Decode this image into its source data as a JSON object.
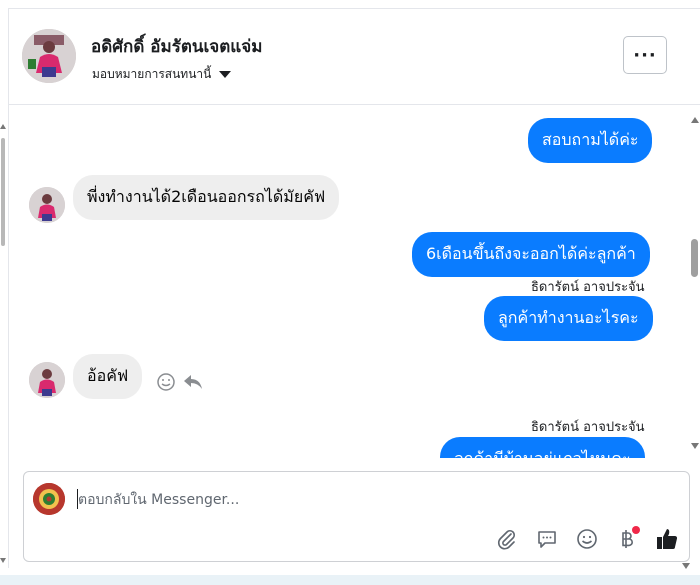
{
  "header": {
    "contact_name": "อดิศักดิ์ อัมรัตนเจตแจ่ม",
    "assign_label": "มอบหมายการสนทนานี้",
    "more_label": "···"
  },
  "messages": [
    {
      "direction": "out",
      "text": "สอบถามได้ค่ะ"
    },
    {
      "direction": "in",
      "text": "พี่งทำงานได้2เดือนออกรถได้มัยคัฟ"
    },
    {
      "direction": "out",
      "text": "6เดือนขึ้นถึงจะออกได้ค่ะลูกค้า"
    },
    {
      "direction": "out",
      "sender": "ธิดารัตน์ อาจประจัน",
      "text": "ลูกค้าทำงานอะไรคะ"
    },
    {
      "direction": "in",
      "text": "อ้อคัฟ"
    },
    {
      "direction": "out",
      "sender": "ธิดารัตน์ อาจประจัน",
      "text": "ลูกค้ามีบ้านอยู่แถวไหนคะ"
    }
  ],
  "composer": {
    "placeholder": "ตอบกลับใน Messenger..."
  },
  "icons": {
    "more": "more-horizontal-icon",
    "caret": "caret-down-icon",
    "react": "smile-icon",
    "reply": "reply-arrow-icon",
    "attach": "paperclip-icon",
    "saved_reply": "chat-bubble-icon",
    "emoji": "smile-icon",
    "payment": "baht-icon",
    "like": "thumbs-up-icon"
  },
  "colors": {
    "outgoing_bubble": "#0a7cff",
    "incoming_bubble": "#eeeeee",
    "notification_dot": "#f02849"
  }
}
